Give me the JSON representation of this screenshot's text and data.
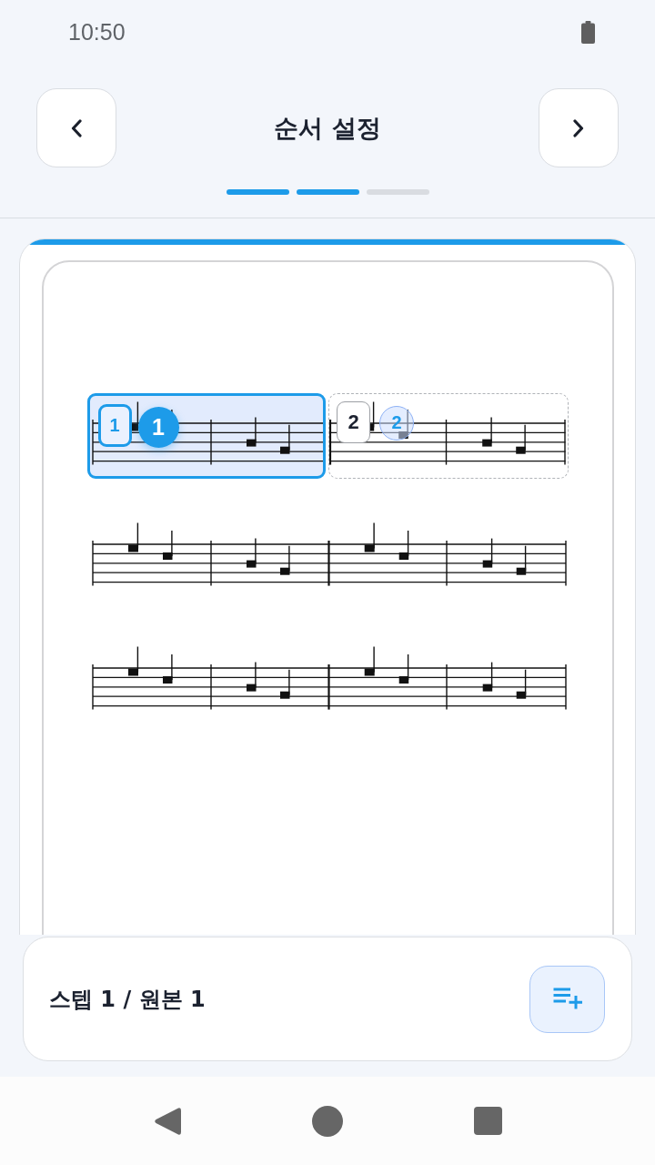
{
  "status_bar": {
    "time": "10:50"
  },
  "header": {
    "title": "순서 설정",
    "progress": [
      {
        "done": true
      },
      {
        "done": true
      },
      {
        "done": false
      }
    ]
  },
  "score": {
    "segments": [
      {
        "step": "1",
        "original": "1",
        "selected": true
      },
      {
        "step": "2",
        "original": "2",
        "selected": false
      }
    ]
  },
  "footer": {
    "label": "스텝 1 / 원본 1"
  }
}
